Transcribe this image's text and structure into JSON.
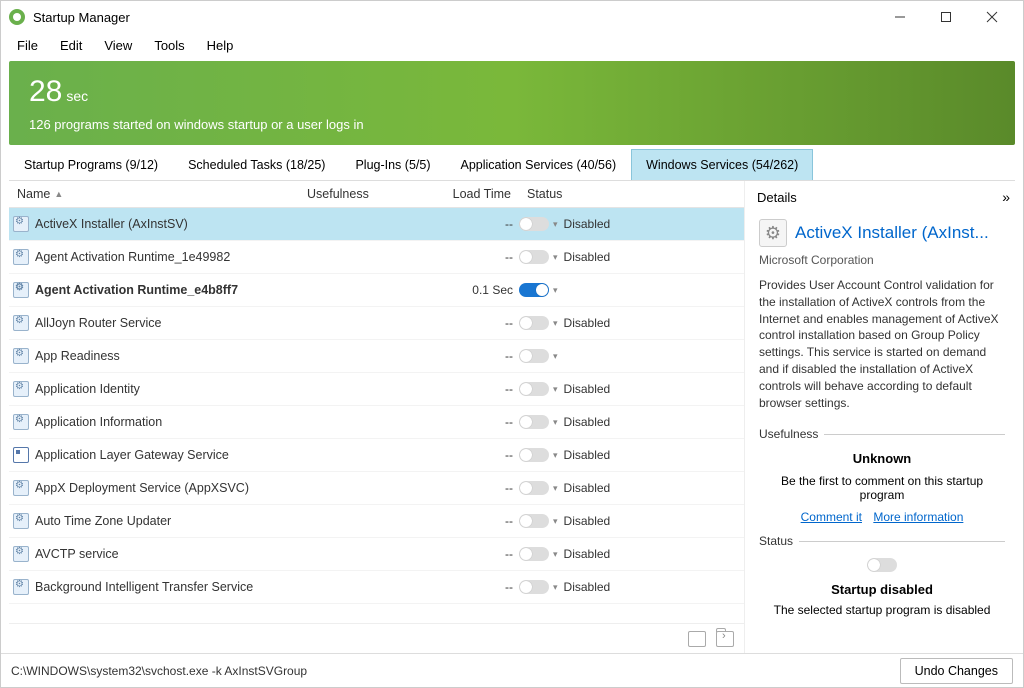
{
  "title": "Startup Manager",
  "menus": [
    "File",
    "Edit",
    "View",
    "Tools",
    "Help"
  ],
  "banner": {
    "value": "28",
    "unit": "sec",
    "subtitle": "126 programs started on windows startup or a user logs in"
  },
  "tabs": [
    {
      "label": "Startup Programs (9/12)"
    },
    {
      "label": "Scheduled Tasks (18/25)"
    },
    {
      "label": "Plug-Ins (5/5)"
    },
    {
      "label": "Application Services (40/56)"
    },
    {
      "label": "Windows Services (54/262)",
      "active": true
    }
  ],
  "columns": {
    "name": "Name",
    "usefulness": "Usefulness",
    "loadtime": "Load Time",
    "status": "Status"
  },
  "rows": [
    {
      "icon": "gear",
      "name": "ActiveX Installer (AxInstSV)",
      "load": "--",
      "enabled": false,
      "status": "Disabled",
      "selected": true
    },
    {
      "icon": "gear",
      "name": "Agent Activation Runtime_1e49982",
      "load": "--",
      "enabled": false,
      "status": "Disabled"
    },
    {
      "icon": "gear",
      "name": "Agent Activation Runtime_e4b8ff7",
      "load": "0.1 Sec",
      "enabled": true,
      "status": "",
      "bold": true
    },
    {
      "icon": "gear",
      "name": "AllJoyn Router Service",
      "load": "--",
      "enabled": false,
      "status": "Disabled"
    },
    {
      "icon": "gear",
      "name": "App Readiness",
      "load": "--",
      "enabled": false,
      "status": ""
    },
    {
      "icon": "gear",
      "name": "Application Identity",
      "load": "--",
      "enabled": false,
      "status": "Disabled"
    },
    {
      "icon": "gear",
      "name": "Application Information",
      "load": "--",
      "enabled": false,
      "status": "Disabled"
    },
    {
      "icon": "box",
      "name": "Application Layer Gateway Service",
      "load": "--",
      "enabled": false,
      "status": "Disabled"
    },
    {
      "icon": "gear",
      "name": "AppX Deployment Service (AppXSVC)",
      "load": "--",
      "enabled": false,
      "status": "Disabled"
    },
    {
      "icon": "gear",
      "name": "Auto Time Zone Updater",
      "load": "--",
      "enabled": false,
      "status": "Disabled"
    },
    {
      "icon": "gear",
      "name": "AVCTP service",
      "load": "--",
      "enabled": false,
      "status": "Disabled"
    },
    {
      "icon": "gear",
      "name": "Background Intelligent Transfer Service",
      "load": "--",
      "enabled": false,
      "status": "Disabled"
    }
  ],
  "details": {
    "header": "Details",
    "title": "ActiveX Installer (AxInst...",
    "vendor": "Microsoft Corporation",
    "description": "Provides User Account Control validation for the installation of ActiveX controls from the Internet and enables management of ActiveX control installation based on Group Policy settings. This service is started on demand and if disabled the installation of ActiveX controls will behave according to default browser settings.",
    "usefulness_head": "Usefulness",
    "unknown": "Unknown",
    "befirst": "Be the first to comment on this startup program",
    "link_comment": "Comment it",
    "link_more": "More information",
    "status_head": "Status",
    "status_title": "Startup disabled",
    "status_desc": "The selected startup program is disabled"
  },
  "statusbar": {
    "path": "C:\\WINDOWS\\system32\\svchost.exe -k AxInstSVGroup",
    "undo": "Undo Changes"
  }
}
